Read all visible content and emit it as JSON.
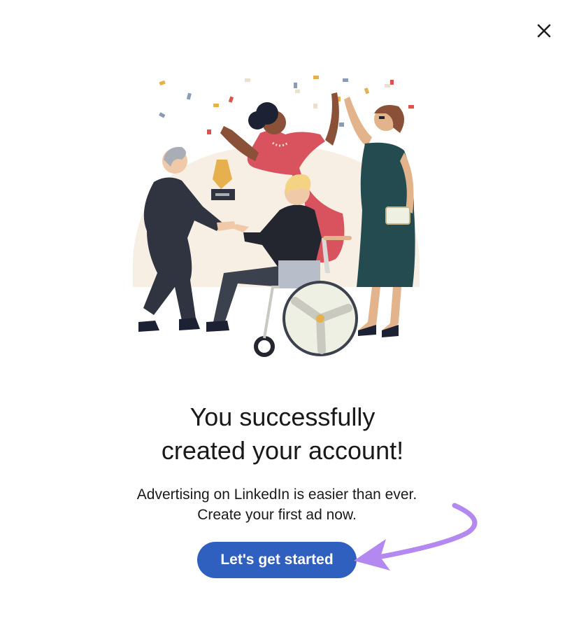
{
  "dialog": {
    "close_icon": "close-icon",
    "illustration": "celebration-illustration",
    "headline_line1": "You successfully",
    "headline_line2": "created your account!",
    "subtext_line1": "Advertising on LinkedIn is easier than ever.",
    "subtext_line2": "Create your first ad now.",
    "cta_label": "Let's get started"
  },
  "colors": {
    "cta_background": "#2f5fbf",
    "cta_text": "#ffffff",
    "annotation_arrow": "#b388f0",
    "text": "#191919"
  }
}
